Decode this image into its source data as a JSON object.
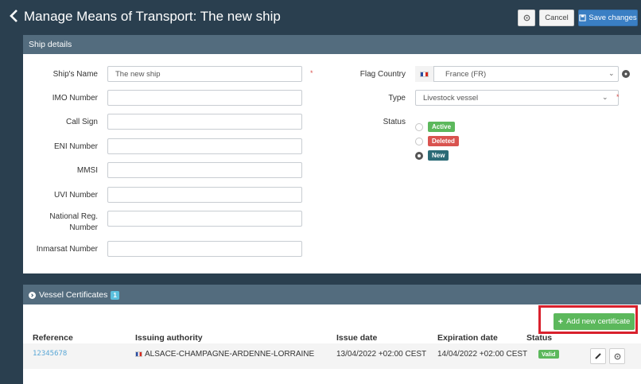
{
  "header": {
    "title": "Manage Means of Transport: The new ship",
    "cancel_label": "Cancel",
    "save_label": "Save changes"
  },
  "ship_details": {
    "title": "Ship details",
    "fields": {
      "name": {
        "label": "Ship's Name",
        "value": "The new ship"
      },
      "imo": {
        "label": "IMO Number",
        "value": ""
      },
      "call_sign": {
        "label": "Call Sign",
        "value": ""
      },
      "eni": {
        "label": "ENI Number",
        "value": ""
      },
      "mmsi": {
        "label": "MMSI",
        "value": ""
      },
      "uvi": {
        "label": "UVI Number",
        "value": ""
      },
      "national_reg": {
        "label_line1": "National Reg.",
        "label_line2": "Number",
        "value": ""
      },
      "inmarsat": {
        "label": "Inmarsat Number",
        "value": ""
      }
    },
    "flag_country": {
      "label": "Flag Country",
      "value": "France (FR)"
    },
    "type": {
      "label": "Type",
      "value": "Livestock vessel"
    },
    "status": {
      "label": "Status",
      "options": [
        "Active",
        "Deleted",
        "New"
      ],
      "selected": "New"
    },
    "required_mark": "*"
  },
  "certificates": {
    "title": "Vessel Certificates",
    "count": "1",
    "add_label": "Add new certificate",
    "columns": [
      "Reference",
      "Issuing authority",
      "Issue date",
      "Expiration date",
      "Status"
    ],
    "rows": [
      {
        "reference": "12345678",
        "authority": "ALSACE-CHAMPAGNE-ARDENNE-LORRAINE",
        "issue_date": "13/04/2022 +02:00 CEST",
        "expiration_date": "14/04/2022 +02:00 CEST",
        "status": "Valid"
      }
    ]
  },
  "colors": {
    "header_bg": "#2a3f4f",
    "panel_head": "#536c7e",
    "primary": "#3a7fc4",
    "success": "#5cb85c",
    "danger": "#d9534f",
    "highlight": "#d9212d"
  },
  "icons": [
    "chevron-left-icon",
    "gear-icon",
    "save-icon",
    "globe-icon",
    "chevron-down-icon",
    "circle-arrow-icon",
    "plus-icon",
    "flag-icon",
    "pencil-icon"
  ]
}
